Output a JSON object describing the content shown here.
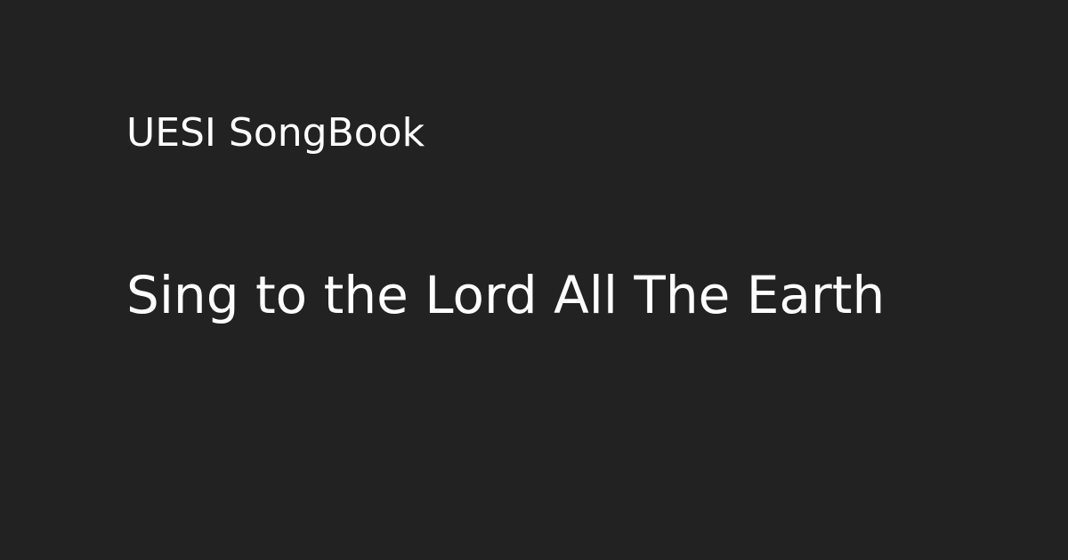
{
  "site": {
    "name": "UESI SongBook"
  },
  "page": {
    "title": "Sing to the Lord All The Earth"
  },
  "colors": {
    "background": "#222222",
    "text": "#ffffff"
  }
}
